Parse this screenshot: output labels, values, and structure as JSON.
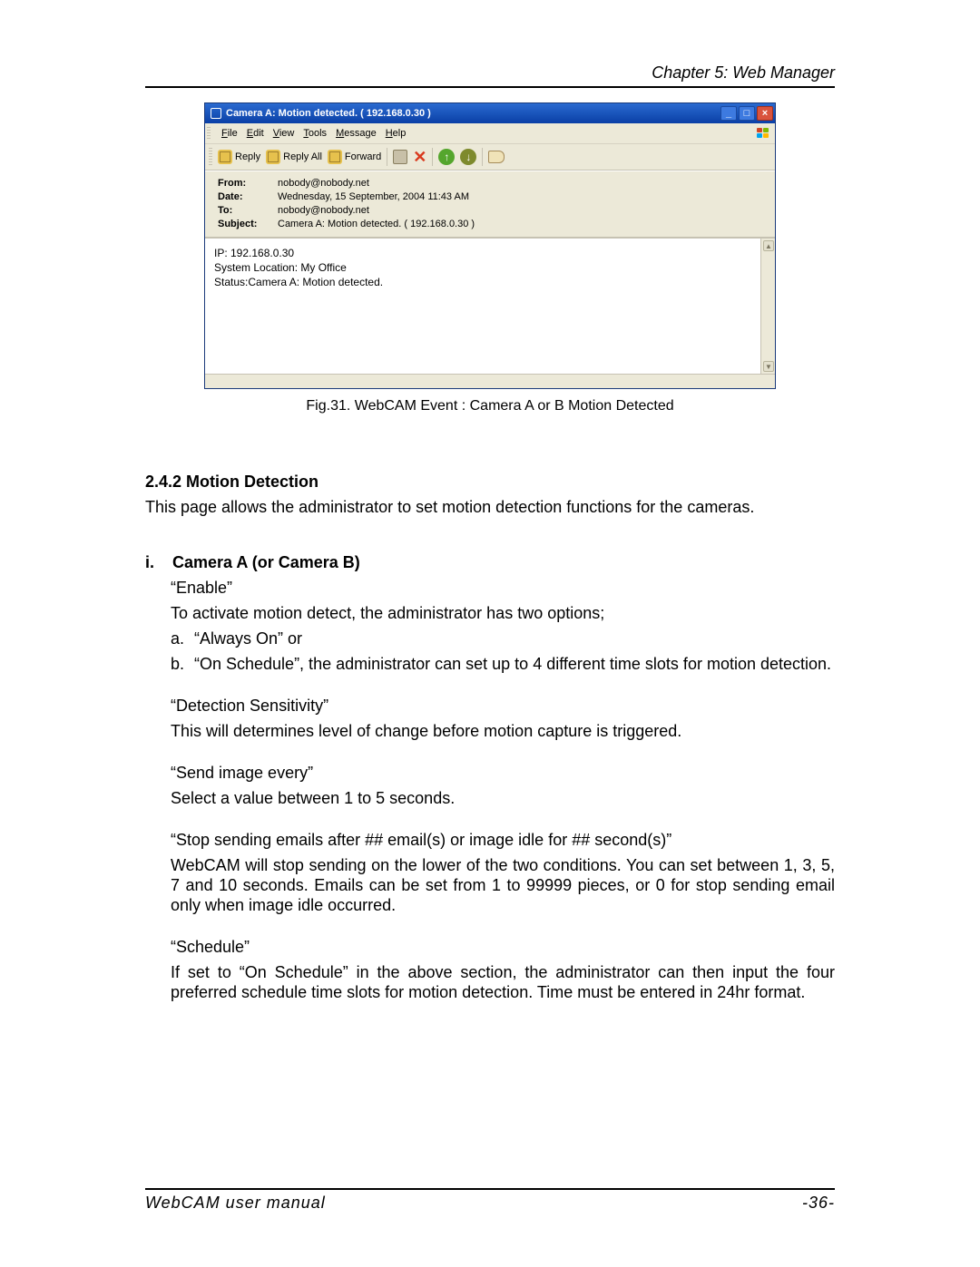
{
  "header": {
    "chapter": "Chapter 5: Web Manager"
  },
  "footer": {
    "manual": "WebCAM user manual",
    "page": "-36-"
  },
  "shot": {
    "title": "Camera A: Motion detected. ( 192.168.0.30 )",
    "menu": {
      "file": "File",
      "edit": "Edit",
      "view": "View",
      "tools": "Tools",
      "message": "Message",
      "help": "Help"
    },
    "toolbar": {
      "reply": "Reply",
      "reply_all": "Reply All",
      "forward": "Forward"
    },
    "headers": {
      "from_label": "From:",
      "from": "nobody@nobody.net",
      "date_label": "Date:",
      "date": "Wednesday, 15 September, 2004 11:43 AM",
      "to_label": "To:",
      "to": "nobody@nobody.net",
      "subject_label": "Subject:",
      "subject": "Camera A: Motion detected. ( 192.168.0.30 )"
    },
    "body": {
      "l1": "IP: 192.168.0.30",
      "l2": "System Location: My Office",
      "l3": "Status:Camera A: Motion detected."
    }
  },
  "caption": "Fig.31.  WebCAM Event : Camera A or B Motion Detected",
  "doc": {
    "sec_num_title": "2.4.2 Motion Detection",
    "sec_intro": "This page allows the administrator to set motion detection functions for the cameras.",
    "sub_i": "i.    Camera A (or Camera B)",
    "enable": "“Enable”",
    "enable_desc": "To activate motion detect, the administrator has two options;",
    "opt_a": "“Always On” or",
    "opt_b": "“On Schedule”, the administrator can set up to 4 different time slots for motion detection.",
    "det_s": "“Detection Sensitivity”",
    "det_s_desc": "This will determines level of change before motion capture is triggered.",
    "send_img": "“Send image every”",
    "send_img_desc": "Select a value between 1 to 5 seconds.",
    "stop_send": "“Stop sending emails after ## email(s) or image idle for ## second(s)”",
    "stop_send_desc": "WebCAM will stop sending on the lower of the two conditions.  You can set between 1, 3, 5, 7 and 10 seconds.   Emails can be set from 1 to 99999 pieces, or 0 for stop sending email only when image idle occurred.",
    "schedule": "“Schedule”",
    "schedule_desc": "If set to “On Schedule” in the above section, the administrator can then input the four preferred schedule time slots for motion detection.   Time must be entered in 24hr format."
  }
}
